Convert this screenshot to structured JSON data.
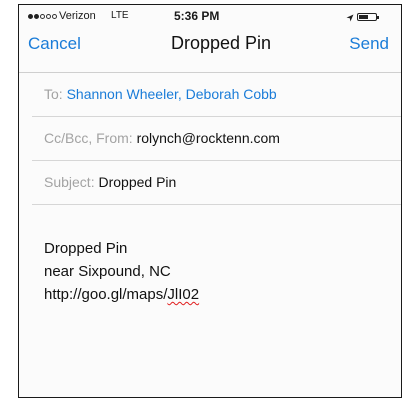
{
  "status_bar": {
    "carrier": "Verizon",
    "network": "LTE",
    "time": "5:36 PM",
    "signal_filled": 2,
    "signal_total": 5,
    "battery_level": 0.55
  },
  "nav": {
    "cancel_label": "Cancel",
    "title": "Dropped Pin",
    "send_label": "Send"
  },
  "fields": {
    "to_label": "To:",
    "to_value": "Shannon Wheeler, Deborah Cobb",
    "ccbcc_label": "Cc/Bcc, From:",
    "from_value": "rolynch@rocktenn.com",
    "subject_label": "Subject:",
    "subject_value": "Dropped Pin"
  },
  "body": {
    "line1": "Dropped Pin",
    "line2": "near Sixpound, NC",
    "link_prefix": "http://goo.gl/maps/",
    "link_suffix": "JlI02"
  },
  "colors": {
    "accent": "#1a7cd8",
    "label_gray": "#a3a3a3",
    "spellcheck_red": "#e11d1d"
  }
}
